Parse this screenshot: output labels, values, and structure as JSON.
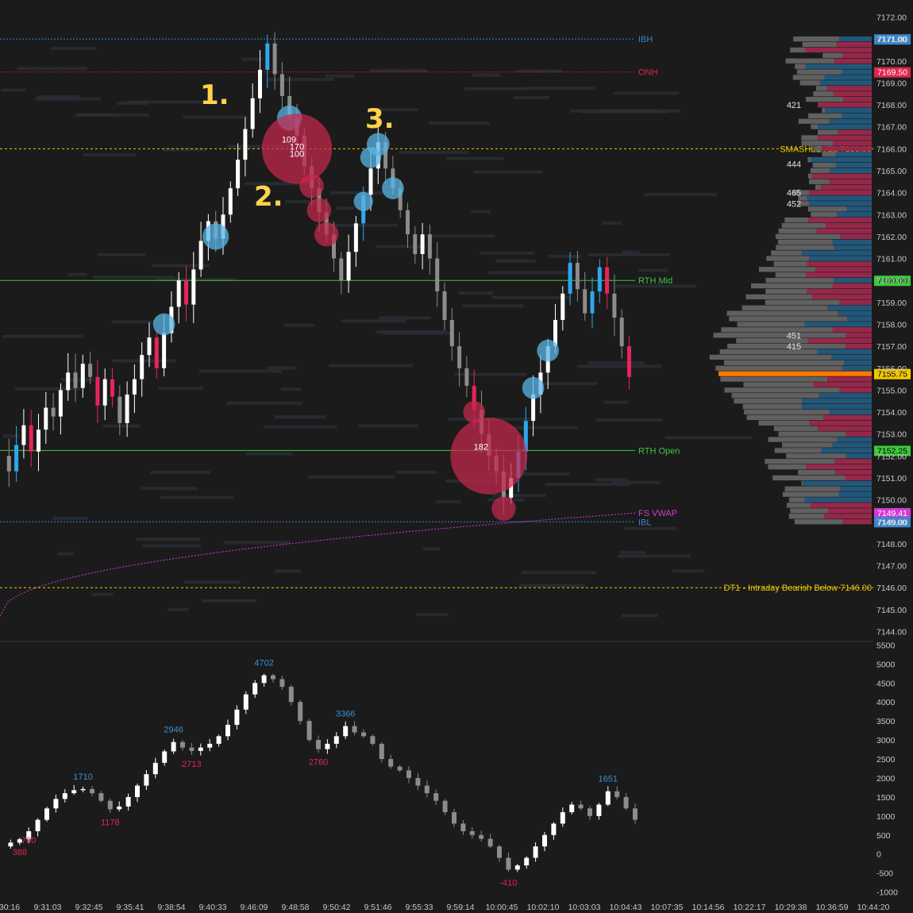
{
  "colors": {
    "background": "#1b1b1b",
    "up_candle": "#ffffff",
    "down_candle": "#8c8c8c",
    "blue_candle": "#2da8f0",
    "red_candle": "#e8245a",
    "blue_bubble": "#5ab4e6",
    "red_bubble": "#c8284e",
    "ibh": "#3a86c8",
    "onh": "#e0264e",
    "rth_line": "#3cc83c",
    "smash_level": "#f0c800",
    "vwap": "#d23cd2",
    "current_price": "#ff7800",
    "profile_gray": "#606060",
    "profile_blue": "#22577a",
    "profile_red": "#96284a",
    "annotation": "#ffd24a",
    "axis_text": "#c8c8c8"
  },
  "annotations": [
    "1.",
    "2.",
    "3."
  ],
  "chart_data": [
    {
      "type": "candlestick",
      "panel": "price",
      "y_ticks": [
        7144,
        7145,
        7146,
        7147,
        7148,
        7149,
        7150,
        7151,
        7152,
        7153,
        7154,
        7155,
        7156,
        7157,
        7158,
        7159,
        7160,
        7161,
        7162,
        7163,
        7164,
        7165,
        7166,
        7167,
        7168,
        7169,
        7170,
        7171,
        7172
      ],
      "tick_labels": [
        "7144.00",
        "7145.00",
        "7146.00",
        "7147.00",
        "7148.00",
        "7149.00",
        "7150.00",
        "7151.00",
        "7152.00",
        "7153.00",
        "7154.00",
        "7155.00",
        "7156.00",
        "7157.00",
        "7158.00",
        "7159.00",
        "7160.00",
        "7161.00",
        "7162.00",
        "7163.00",
        "7164.00",
        "7165.00",
        "7166.00",
        "7167.00",
        "7168.00",
        "7169.00",
        "7170.00",
        "7171.00",
        "7172.00"
      ],
      "ylim": [
        7143.8,
        7172.2
      ],
      "close_path": [
        7152.0,
        7151.3,
        7152.5,
        7153.4,
        7152.2,
        7153.2,
        7154.2,
        7153.8,
        7155.0,
        7155.8,
        7155.1,
        7156.2,
        7155.6,
        7154.3,
        7155.5,
        7154.7,
        7153.5,
        7154.8,
        7155.5,
        7156.6,
        7157.4,
        7156.0,
        7157.6,
        7158.8,
        7160.0,
        7158.9,
        7160.5,
        7161.8,
        7162.7,
        7161.9,
        7163.0,
        7164.2,
        7165.5,
        7166.9,
        7168.3,
        7169.6,
        7170.8,
        7169.4,
        7168.4,
        7167.4,
        7166.6,
        7165.2,
        7164.2,
        7163.1,
        7162.1,
        7161.0,
        7160.0,
        7161.3,
        7162.6,
        7163.9,
        7165.1,
        7166.3,
        7165.1,
        7164.2,
        7163.2,
        7162.1,
        7161.2,
        7162.1,
        7161.0,
        7159.5,
        7158.2,
        7157.0,
        7156.0,
        7155.2,
        7154.1,
        7153.0,
        7152.0,
        7151.3,
        7150.1,
        7151.0,
        7152.2,
        7153.6,
        7154.8,
        7155.8,
        7157.0,
        7158.2,
        7159.4,
        7160.8,
        7159.6,
        7158.5,
        7159.5,
        7160.6,
        7159.4,
        7158.3,
        7157.0,
        7155.6
      ],
      "levels": [
        {
          "label": "IBH",
          "price": 7171.0,
          "price_label": "7171.00"
        },
        {
          "label": "ONH",
          "price": 7169.5,
          "price_label": "7169.50"
        },
        {
          "label": "SMASHLEVEL",
          "price": 7166.0,
          "price_label": "7166.00"
        },
        {
          "label": "RTH Mid",
          "price": 7160.0,
          "price_label": "7160.00"
        },
        {
          "label": "RTH Open",
          "price": 7152.25,
          "price_label": "7152.25"
        },
        {
          "label": "FS VWAP",
          "price": 7149.41,
          "price_label": "7149.41"
        },
        {
          "label": "IBL",
          "price": 7149.0,
          "price_label": "7149.00"
        },
        {
          "label": "DT1 - Intraday Bearish Below",
          "price": 7146.0,
          "price_label": "7146.00"
        }
      ],
      "current_price": {
        "price": 7155.75,
        "label": "7155.75"
      },
      "bubbles_blue": [
        [
          7167.4,
          0.57
        ],
        [
          7162.0,
          0.6
        ],
        [
          7158.0,
          0.5
        ],
        [
          7166.2,
          0.52
        ],
        [
          7165.6,
          0.48
        ],
        [
          7164.2,
          0.5
        ],
        [
          7163.6,
          0.44
        ],
        [
          7156.8,
          0.5
        ],
        [
          7155.1,
          0.5
        ]
      ],
      "bubbles_red": [
        {
          "price": 7166.0,
          "r": 1.6,
          "labels": [
            "109",
            "170",
            "100"
          ]
        },
        {
          "price": 7164.3,
          "r": 0.55,
          "labels": []
        },
        {
          "price": 7163.2,
          "r": 0.55,
          "labels": []
        },
        {
          "price": 7162.1,
          "r": 0.55,
          "labels": []
        },
        {
          "price": 7154.0,
          "r": 0.5,
          "labels": []
        },
        {
          "price": 7152.0,
          "r": 1.75,
          "labels": [
            "182"
          ]
        },
        {
          "price": 7149.6,
          "r": 0.55,
          "labels": []
        }
      ],
      "profile_labels": [
        {
          "price": 7168.0,
          "text": "421"
        },
        {
          "price": 7165.3,
          "text": "444"
        },
        {
          "price": 7164.0,
          "text": "465"
        },
        {
          "price": 7163.5,
          "text": "452"
        },
        {
          "price": 7157.5,
          "text": "451"
        },
        {
          "price": 7157.0,
          "text": "415"
        }
      ]
    },
    {
      "type": "candlestick",
      "panel": "cumulative delta",
      "y_ticks": [
        -1000,
        -500,
        0,
        500,
        1000,
        1500,
        2000,
        2500,
        3000,
        3500,
        4000,
        4500,
        5000,
        5500
      ],
      "ylim": [
        -1050,
        5550
      ],
      "x_tick_labels": [
        "30:16",
        "9:31:03",
        "9:32:45",
        "9:35:41",
        "9:38:54",
        "9:40:33",
        "9:46:09",
        "9:48:58",
        "9:50:42",
        "9:51:46",
        "9:55:33",
        "9:59:14",
        "10:00:45",
        "10:02:10",
        "10:03:03",
        "10:04:43",
        "10:07:35",
        "10:14:56",
        "10:22:17",
        "10:29:38",
        "10:36:59",
        "10:44:20"
      ],
      "close_path": [
        200,
        300,
        388,
        600,
        900,
        1200,
        1450,
        1600,
        1680,
        1710,
        1600,
        1400,
        1178,
        1250,
        1500,
        1800,
        2100,
        2400,
        2700,
        2946,
        2800,
        2713,
        2800,
        2900,
        3100,
        3400,
        3800,
        4200,
        4500,
        4702,
        4600,
        4400,
        4000,
        3500,
        3000,
        2760,
        2900,
        3100,
        3366,
        3200,
        3100,
        2900,
        2500,
        2300,
        2200,
        2000,
        1800,
        1600,
        1400,
        1100,
        800,
        600,
        500,
        400,
        200,
        -100,
        -410,
        -300,
        -100,
        200,
        500,
        800,
        1100,
        1300,
        1200,
        1000,
        1300,
        1651,
        1500,
        1200,
        900
      ],
      "annotations": [
        {
          "value": 4702,
          "text": "4702",
          "kind": "high"
        },
        {
          "value": 3366,
          "text": "3366",
          "kind": "high"
        },
        {
          "value": 2946,
          "text": "2946",
          "kind": "high"
        },
        {
          "value": 1710,
          "text": "1710",
          "kind": "high"
        },
        {
          "value": 1651,
          "text": "1651",
          "kind": "high"
        },
        {
          "value": 2760,
          "text": "2760",
          "kind": "low"
        },
        {
          "value": 2713,
          "text": "2713",
          "kind": "low"
        },
        {
          "value": 1178,
          "text": "1178",
          "kind": "low"
        },
        {
          "value": 388,
          "text": "388",
          "kind": "low"
        },
        {
          "value": 700,
          "text": "700",
          "kind": "low"
        },
        {
          "value": -410,
          "text": "-410",
          "kind": "low"
        }
      ]
    }
  ]
}
